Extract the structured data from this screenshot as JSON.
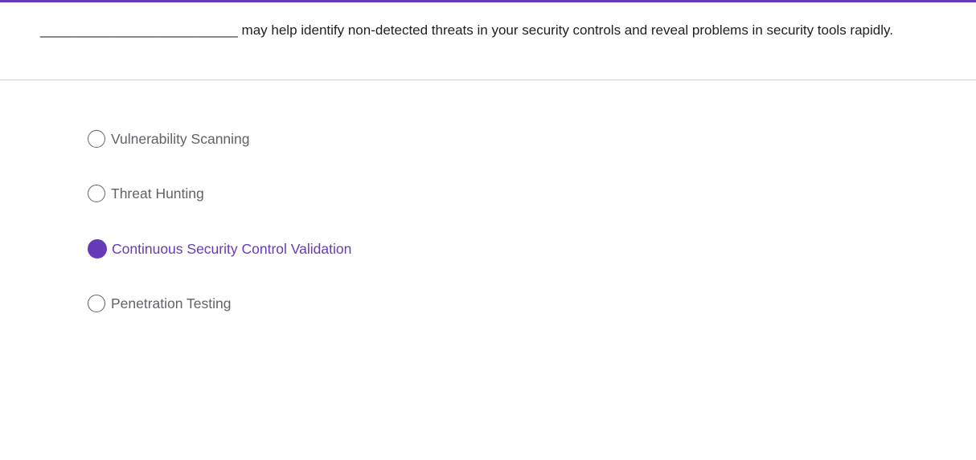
{
  "accent_color": "#673ab7",
  "question": {
    "blank": "__________________________",
    "text": " may help identify non-detected threats in your security controls and reveal problems in security tools rapidly."
  },
  "options": [
    {
      "label": "Vulnerability Scanning",
      "selected": false
    },
    {
      "label": "Threat Hunting",
      "selected": false
    },
    {
      "label": "Continuous Security Control Validation",
      "selected": true
    },
    {
      "label": "Penetration Testing",
      "selected": false
    }
  ]
}
